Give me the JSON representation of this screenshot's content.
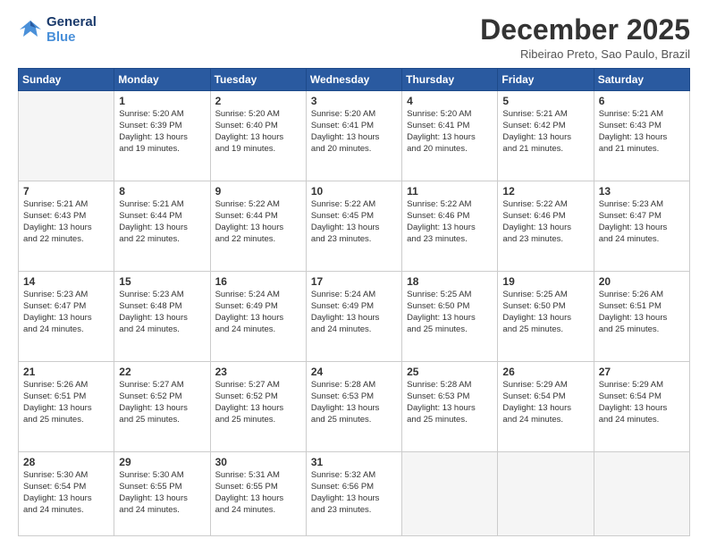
{
  "logo": {
    "line1": "General",
    "line2": "Blue"
  },
  "title": "December 2025",
  "location": "Ribeirao Preto, Sao Paulo, Brazil",
  "weekdays": [
    "Sunday",
    "Monday",
    "Tuesday",
    "Wednesday",
    "Thursday",
    "Friday",
    "Saturday"
  ],
  "weeks": [
    [
      {
        "day": "",
        "info": ""
      },
      {
        "day": "1",
        "info": "Sunrise: 5:20 AM\nSunset: 6:39 PM\nDaylight: 13 hours\nand 19 minutes."
      },
      {
        "day": "2",
        "info": "Sunrise: 5:20 AM\nSunset: 6:40 PM\nDaylight: 13 hours\nand 19 minutes."
      },
      {
        "day": "3",
        "info": "Sunrise: 5:20 AM\nSunset: 6:41 PM\nDaylight: 13 hours\nand 20 minutes."
      },
      {
        "day": "4",
        "info": "Sunrise: 5:20 AM\nSunset: 6:41 PM\nDaylight: 13 hours\nand 20 minutes."
      },
      {
        "day": "5",
        "info": "Sunrise: 5:21 AM\nSunset: 6:42 PM\nDaylight: 13 hours\nand 21 minutes."
      },
      {
        "day": "6",
        "info": "Sunrise: 5:21 AM\nSunset: 6:43 PM\nDaylight: 13 hours\nand 21 minutes."
      }
    ],
    [
      {
        "day": "7",
        "info": "Sunrise: 5:21 AM\nSunset: 6:43 PM\nDaylight: 13 hours\nand 22 minutes."
      },
      {
        "day": "8",
        "info": "Sunrise: 5:21 AM\nSunset: 6:44 PM\nDaylight: 13 hours\nand 22 minutes."
      },
      {
        "day": "9",
        "info": "Sunrise: 5:22 AM\nSunset: 6:44 PM\nDaylight: 13 hours\nand 22 minutes."
      },
      {
        "day": "10",
        "info": "Sunrise: 5:22 AM\nSunset: 6:45 PM\nDaylight: 13 hours\nand 23 minutes."
      },
      {
        "day": "11",
        "info": "Sunrise: 5:22 AM\nSunset: 6:46 PM\nDaylight: 13 hours\nand 23 minutes."
      },
      {
        "day": "12",
        "info": "Sunrise: 5:22 AM\nSunset: 6:46 PM\nDaylight: 13 hours\nand 23 minutes."
      },
      {
        "day": "13",
        "info": "Sunrise: 5:23 AM\nSunset: 6:47 PM\nDaylight: 13 hours\nand 24 minutes."
      }
    ],
    [
      {
        "day": "14",
        "info": "Sunrise: 5:23 AM\nSunset: 6:47 PM\nDaylight: 13 hours\nand 24 minutes."
      },
      {
        "day": "15",
        "info": "Sunrise: 5:23 AM\nSunset: 6:48 PM\nDaylight: 13 hours\nand 24 minutes."
      },
      {
        "day": "16",
        "info": "Sunrise: 5:24 AM\nSunset: 6:49 PM\nDaylight: 13 hours\nand 24 minutes."
      },
      {
        "day": "17",
        "info": "Sunrise: 5:24 AM\nSunset: 6:49 PM\nDaylight: 13 hours\nand 24 minutes."
      },
      {
        "day": "18",
        "info": "Sunrise: 5:25 AM\nSunset: 6:50 PM\nDaylight: 13 hours\nand 25 minutes."
      },
      {
        "day": "19",
        "info": "Sunrise: 5:25 AM\nSunset: 6:50 PM\nDaylight: 13 hours\nand 25 minutes."
      },
      {
        "day": "20",
        "info": "Sunrise: 5:26 AM\nSunset: 6:51 PM\nDaylight: 13 hours\nand 25 minutes."
      }
    ],
    [
      {
        "day": "21",
        "info": "Sunrise: 5:26 AM\nSunset: 6:51 PM\nDaylight: 13 hours\nand 25 minutes."
      },
      {
        "day": "22",
        "info": "Sunrise: 5:27 AM\nSunset: 6:52 PM\nDaylight: 13 hours\nand 25 minutes."
      },
      {
        "day": "23",
        "info": "Sunrise: 5:27 AM\nSunset: 6:52 PM\nDaylight: 13 hours\nand 25 minutes."
      },
      {
        "day": "24",
        "info": "Sunrise: 5:28 AM\nSunset: 6:53 PM\nDaylight: 13 hours\nand 25 minutes."
      },
      {
        "day": "25",
        "info": "Sunrise: 5:28 AM\nSunset: 6:53 PM\nDaylight: 13 hours\nand 25 minutes."
      },
      {
        "day": "26",
        "info": "Sunrise: 5:29 AM\nSunset: 6:54 PM\nDaylight: 13 hours\nand 24 minutes."
      },
      {
        "day": "27",
        "info": "Sunrise: 5:29 AM\nSunset: 6:54 PM\nDaylight: 13 hours\nand 24 minutes."
      }
    ],
    [
      {
        "day": "28",
        "info": "Sunrise: 5:30 AM\nSunset: 6:54 PM\nDaylight: 13 hours\nand 24 minutes."
      },
      {
        "day": "29",
        "info": "Sunrise: 5:30 AM\nSunset: 6:55 PM\nDaylight: 13 hours\nand 24 minutes."
      },
      {
        "day": "30",
        "info": "Sunrise: 5:31 AM\nSunset: 6:55 PM\nDaylight: 13 hours\nand 24 minutes."
      },
      {
        "day": "31",
        "info": "Sunrise: 5:32 AM\nSunset: 6:56 PM\nDaylight: 13 hours\nand 23 minutes."
      },
      {
        "day": "",
        "info": ""
      },
      {
        "day": "",
        "info": ""
      },
      {
        "day": "",
        "info": ""
      }
    ]
  ]
}
